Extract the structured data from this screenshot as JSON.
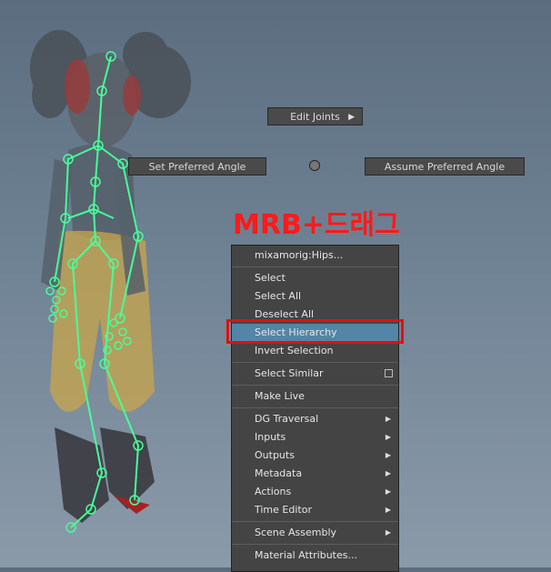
{
  "marking_menu": {
    "north": "Edit Joints",
    "west": "Set Preferred Angle",
    "east": "Assume Preferred Angle"
  },
  "annotation": "MRB+드래그",
  "context_menu": {
    "title": "mixamorig:Hips...",
    "items": [
      "Select",
      "Select All",
      "Deselect All",
      "Select Hierarchy",
      "Invert Selection",
      "Select Similar",
      "Make Live",
      "DG Traversal",
      "Inputs",
      "Outputs",
      "Metadata",
      "Actions",
      "Time Editor",
      "Scene Assembly",
      "Material Attributes..."
    ],
    "highlighted": "Select Hierarchy"
  },
  "colors": {
    "highlight": "#5285a6",
    "annotation": "#ff1a1a",
    "joint": "#46ff9a"
  }
}
